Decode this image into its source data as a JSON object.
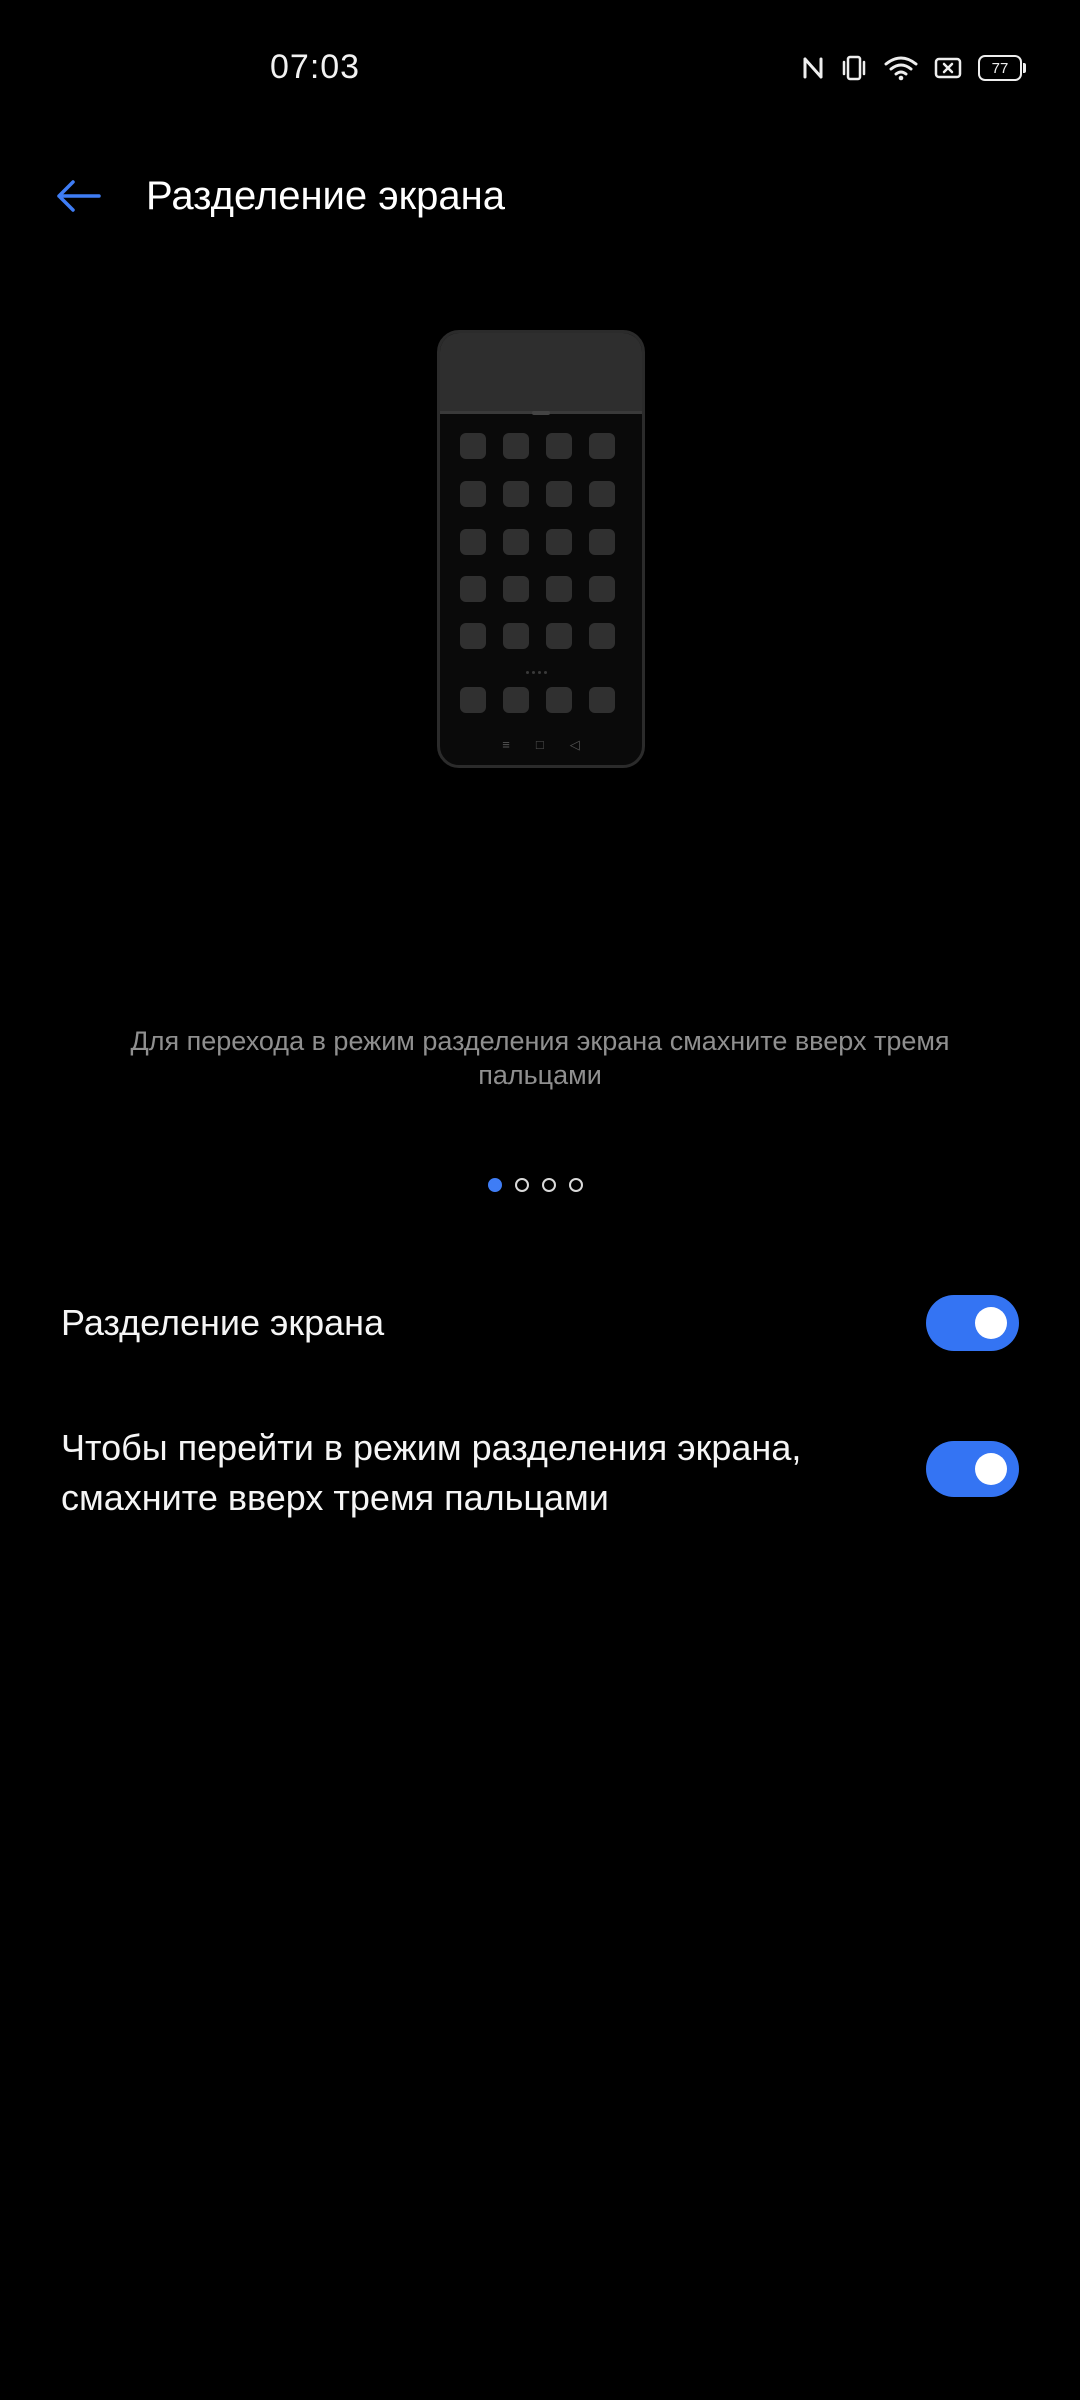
{
  "status_bar": {
    "time": "07:03",
    "battery": "77",
    "icons": [
      "nfc-icon",
      "vibrate-icon",
      "wifi-icon",
      "screen-record-icon",
      "battery-icon"
    ]
  },
  "header": {
    "title": "Разделение экрана",
    "back_icon": "arrow-left-icon"
  },
  "illustration": {
    "description": "Для перехода в режим разделения экрана смахните вверх тремя пальцами"
  },
  "pager": {
    "total": 4,
    "active": 1
  },
  "settings": [
    {
      "label": "Разделение экрана",
      "enabled": true
    },
    {
      "label": "Чтобы перейти в режим разделения экрана, смахните вверх тремя пальцами",
      "enabled": true
    }
  ],
  "colors": {
    "accent": "#3474f3",
    "background": "#000000",
    "secondary_text": "#8f8f8f"
  }
}
